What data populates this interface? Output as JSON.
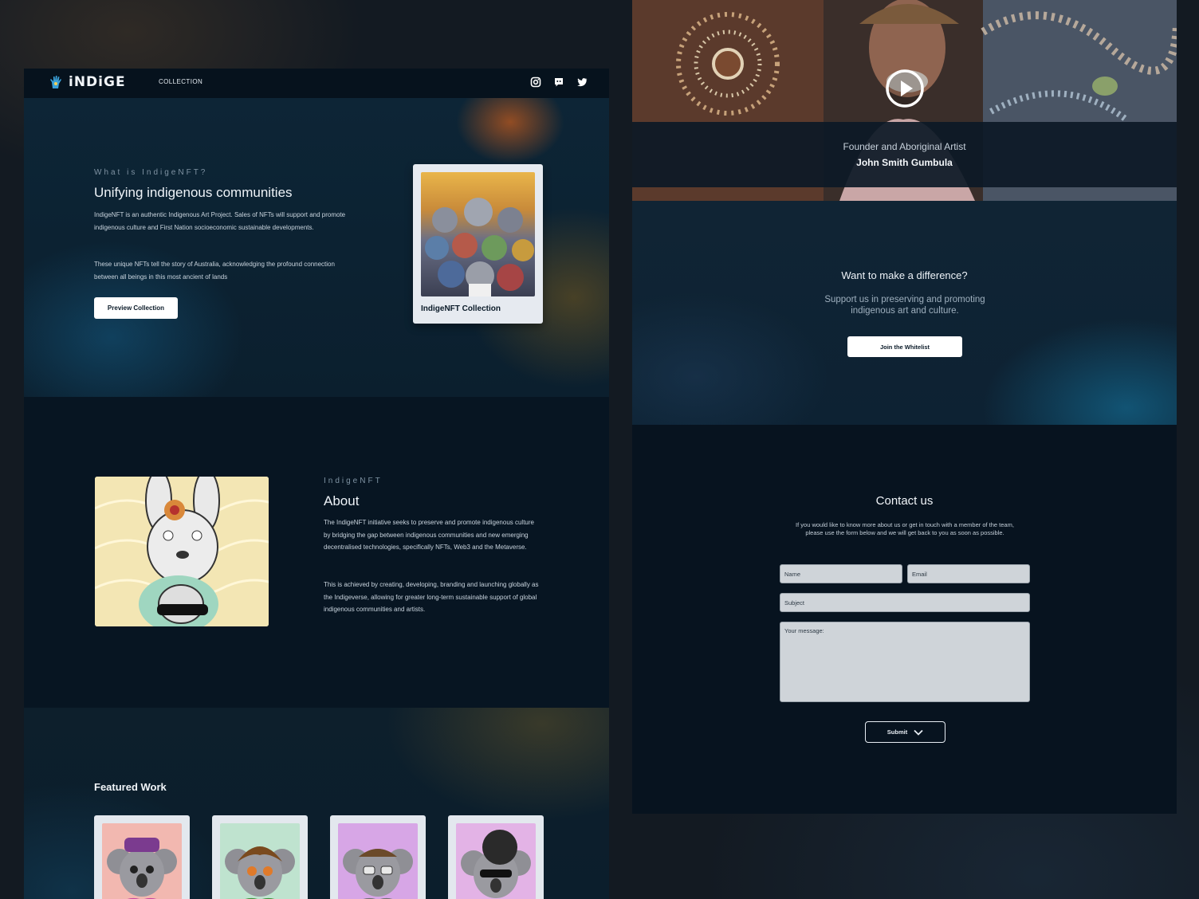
{
  "nav": {
    "logo_text": "iNDiGE",
    "collection_link": "COLLECTION",
    "social_icons": [
      "instagram-icon",
      "discord-icon",
      "twitter-icon"
    ]
  },
  "hero": {
    "eyebrow": "What is IndigeNFT?",
    "title": "Unifying indigenous communities",
    "paragraph_1": "IndigeNFT is an authentic Indigenous Art Project. Sales of NFTs will support and promote indigenous culture and First Nation socioeconomic sustainable developments.",
    "paragraph_2": "These unique NFTs tell the story of Australia, acknowledging the profound connection between all beings in this most ancient of lands",
    "button_label": "Preview Collection",
    "card_label": "IndigeNFT Collection"
  },
  "about": {
    "eyebrow": "IndigeNFT",
    "title": "About",
    "paragraph_1": "The IndigeNFT initiative seeks to preserve and promote indigenous culture by bridging the gap between indigenous communities and new emerging decentralised technologies, specifically NFTs, Web3 and the Metaverse.",
    "paragraph_2": "This is achieved by creating, developing, branding and launching globally as the Indigeverse, allowing for greater long-term sustainable support of global indigenous communities and artists."
  },
  "featured": {
    "title": "Featured Work",
    "cards": [
      {
        "bg": "#f2b8b0",
        "accent": "#c9479f"
      },
      {
        "bg": "#bfe3cf",
        "accent": "#7a4a1e"
      },
      {
        "bg": "#d7a6e6",
        "accent": "#6f6f6f"
      },
      {
        "bg": "#e3b3e6",
        "accent": "#3a3a3a"
      }
    ]
  },
  "video": {
    "role": "Founder and Aboriginal Artist",
    "name": "John Smith Gumbula"
  },
  "cta": {
    "title": "Want to make a difference?",
    "subtitle": "Support us in preserving and promoting indigenous art and culture.",
    "button_label": "Join the Whitelist"
  },
  "contact": {
    "title": "Contact us",
    "subtitle": "If you would like to know more about us or get in touch with a member of the team, please use the form below and we will get back to you as soon as possible.",
    "name_placeholder": "Name",
    "email_placeholder": "Email",
    "subject_placeholder": "Subject",
    "message_placeholder": "Your message:",
    "submit_label": "Submit"
  },
  "colors": {
    "page_bg": "#131a22",
    "panel_bg": "#081724",
    "button_bg": "#ffffff",
    "field_bg": "#cfd4d9"
  }
}
